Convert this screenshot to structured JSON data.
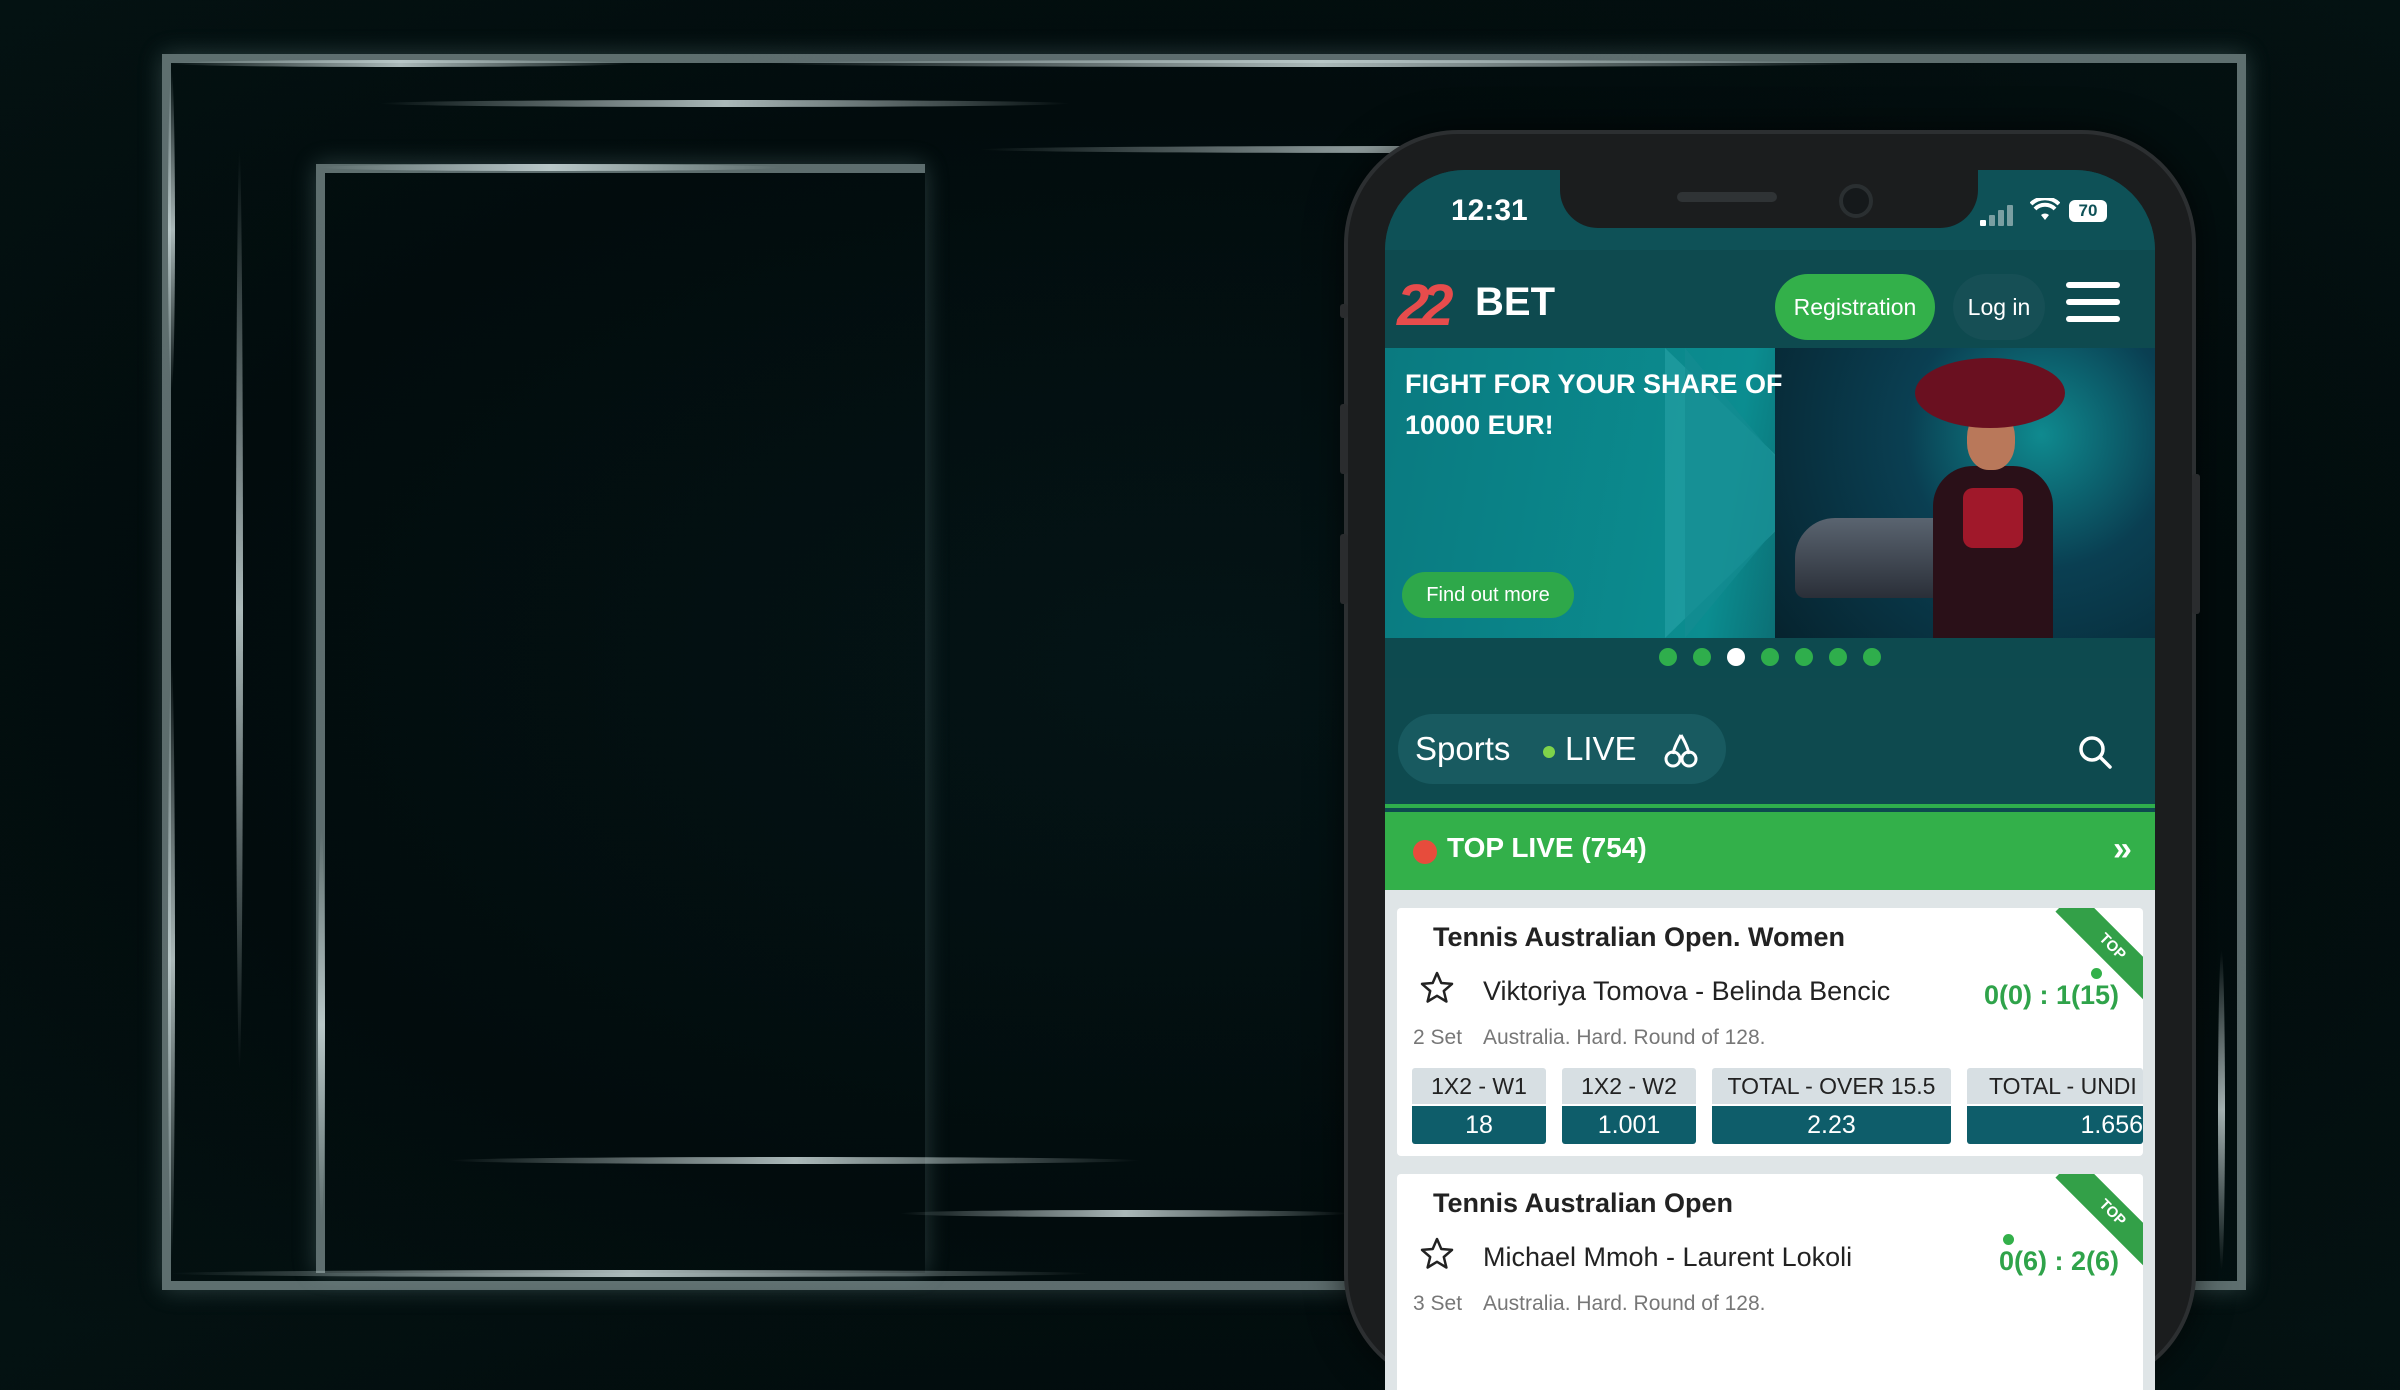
{
  "status_bar": {
    "time": "12:31",
    "battery": "70"
  },
  "header": {
    "logo_22": "22",
    "logo_bet": "BET",
    "registration_label": "Registration",
    "login_label": "Log in"
  },
  "banner": {
    "title": "FIGHT FOR YOUR SHARE OF 10000 EUR!",
    "cta_label": "Find out more",
    "slide_count": 7,
    "active_slide": 3
  },
  "nav": {
    "sports_label": "Sports",
    "live_label": "LIVE"
  },
  "top_live": {
    "title": "TOP LIVE (754)"
  },
  "colors": {
    "brand_green": "#33b04a",
    "header_teal": "#0e4a4f",
    "odds_teal": "#0e5d6a",
    "logo_red": "#e74c4c"
  },
  "matches": [
    {
      "league": "Tennis Australian Open. Women",
      "teams": "Viktoriya Tomova - Belinda Bencic",
      "score": "0(0)  :  1(15)",
      "set": "2 Set",
      "info": "Australia. Hard. Round of 128.",
      "badge": "TOP",
      "odds": [
        {
          "label": "1X2 - W1",
          "value": "18"
        },
        {
          "label": "1X2 - W2",
          "value": "1.001"
        },
        {
          "label": "TOTAL - OVER 15.5",
          "value": "2.23"
        },
        {
          "label": "TOTAL - UNDI",
          "value": "1.656"
        }
      ]
    },
    {
      "league": "Tennis Australian Open",
      "teams": "Michael Mmoh - Laurent Lokoli",
      "score": "0(6)  :  2(6)",
      "set": "3 Set",
      "info": "Australia. Hard. Round of 128.",
      "badge": "TOP"
    }
  ]
}
